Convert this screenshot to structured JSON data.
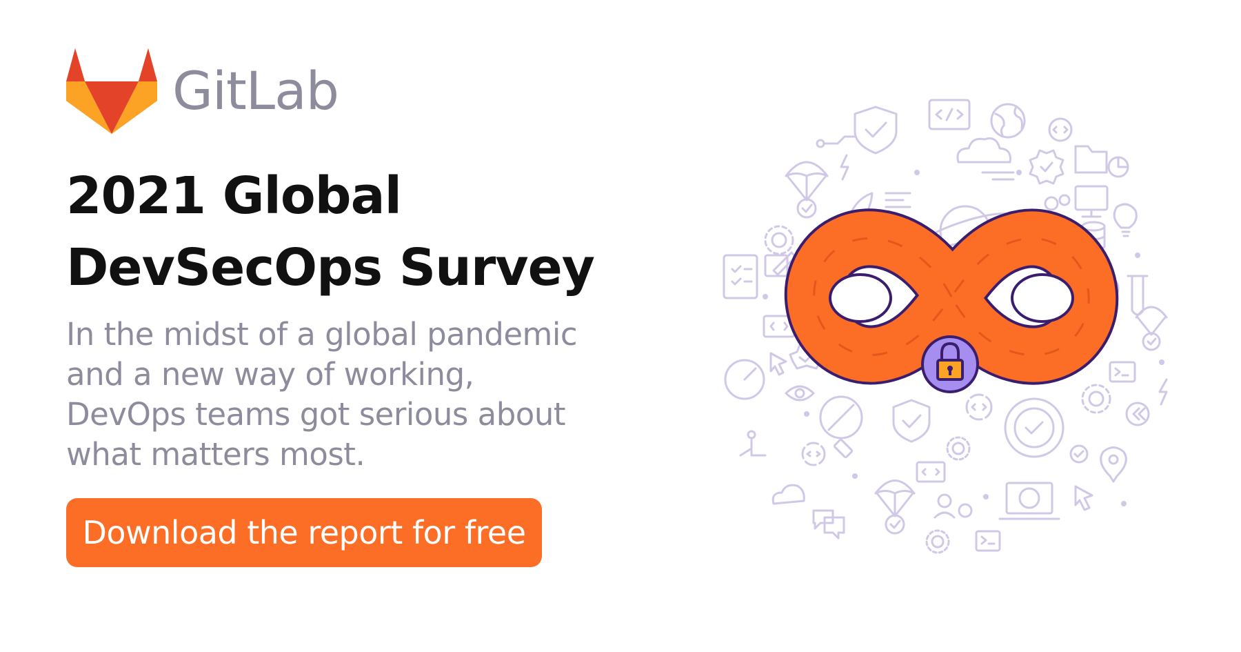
{
  "brand": {
    "name": "GitLab",
    "logo_icon": "gitlab-tanuki-icon",
    "colors": {
      "red": "#e24329",
      "orange": "#fc6d26",
      "amber": "#fca326",
      "text": "#8c8c9c"
    }
  },
  "headline": {
    "line1": "2021 Global",
    "line2": "DevSecOps Survey"
  },
  "subtext": {
    "line1": "In the midst of a global pandemic",
    "line2": "and a new way of working,",
    "line3": "DevOps teams got serious about",
    "line4": "what matters most."
  },
  "cta": {
    "label": "Download the report for free",
    "color": "#fc6d26"
  },
  "illustration": {
    "central_icon": "infinity-loop-icon",
    "badge_icon": "padlock-icon",
    "accent": "#fc6d26",
    "outline": "#3b1d6e",
    "icon_tint": "#cfc7e6",
    "icons": [
      "shield-check-icon",
      "code-window-icon",
      "globe-icon",
      "cloud-icon",
      "parachute-icon",
      "rocket-icon",
      "gear-icon",
      "planet-icon",
      "folder-icon",
      "computer-icon",
      "clipboard-checklist-icon",
      "lightbulb-icon",
      "database-icon",
      "gauge-icon",
      "eye-icon",
      "satellite-icon",
      "target-icon",
      "laptop-icon",
      "terminal-icon",
      "chat-bubble-icon",
      "test-tube-icon",
      "cursor-icon",
      "users-icon",
      "location-pin-icon",
      "lightning-icon"
    ]
  }
}
